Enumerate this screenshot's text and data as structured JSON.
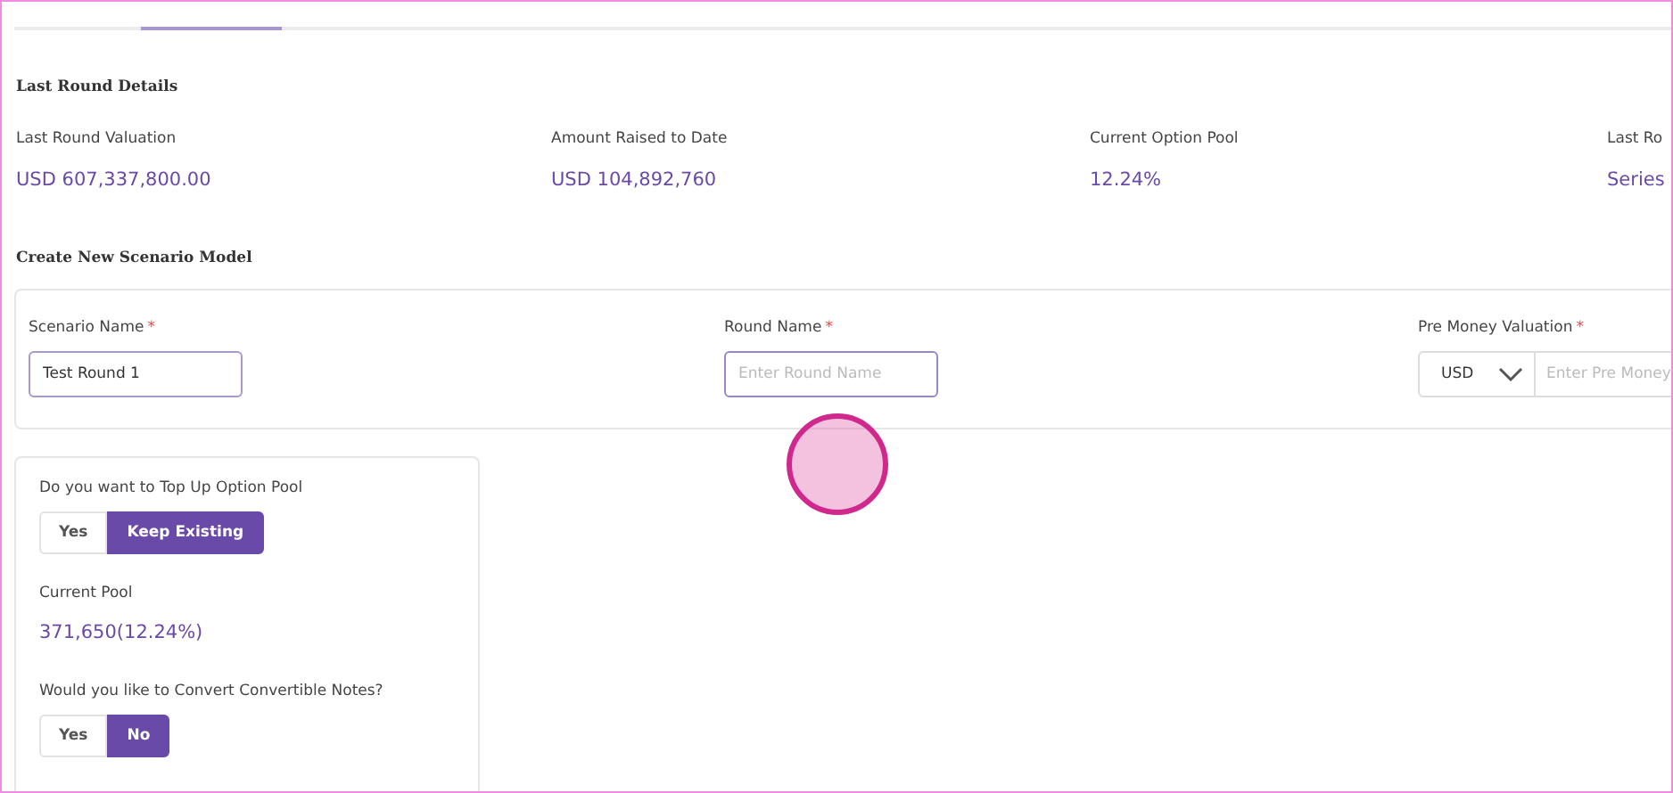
{
  "last_round": {
    "title": "Last Round Details",
    "stats": [
      {
        "label": "Last Round Valuation",
        "value": "USD 607,337,800.00"
      },
      {
        "label": "Amount Raised to Date",
        "value": "USD 104,892,760"
      },
      {
        "label": "Current Option Pool",
        "value": "12.24%"
      },
      {
        "label": "Last Ro",
        "value": "Series"
      }
    ]
  },
  "scenario": {
    "title": "Create New Scenario Model",
    "fields": [
      {
        "kind": "text",
        "label": "Scenario Name",
        "required_mark": "*",
        "value": "Test Round 1"
      },
      {
        "kind": "text",
        "label": "Round Name",
        "required_mark": "*",
        "placeholder": "Enter Round Name",
        "focused": true
      },
      {
        "kind": "currency",
        "label": "Pre Money Valuation",
        "required_mark": "*",
        "currency": "USD",
        "placeholder": "Enter Pre Money"
      }
    ]
  },
  "options": {
    "top_up": {
      "question": "Do you want to Top Up Option Pool",
      "choices": [
        {
          "label": "Yes",
          "selected": false
        },
        {
          "label": "Keep Existing",
          "selected": true
        }
      ]
    },
    "current_pool": {
      "label": "Current Pool",
      "value": "371,650(12.24%)"
    },
    "convert_notes": {
      "question": "Would you like to Convert Convertible Notes?",
      "choices": [
        {
          "label": "Yes",
          "selected": false
        },
        {
          "label": "No",
          "selected": true
        }
      ]
    }
  },
  "click_indicator": true
}
